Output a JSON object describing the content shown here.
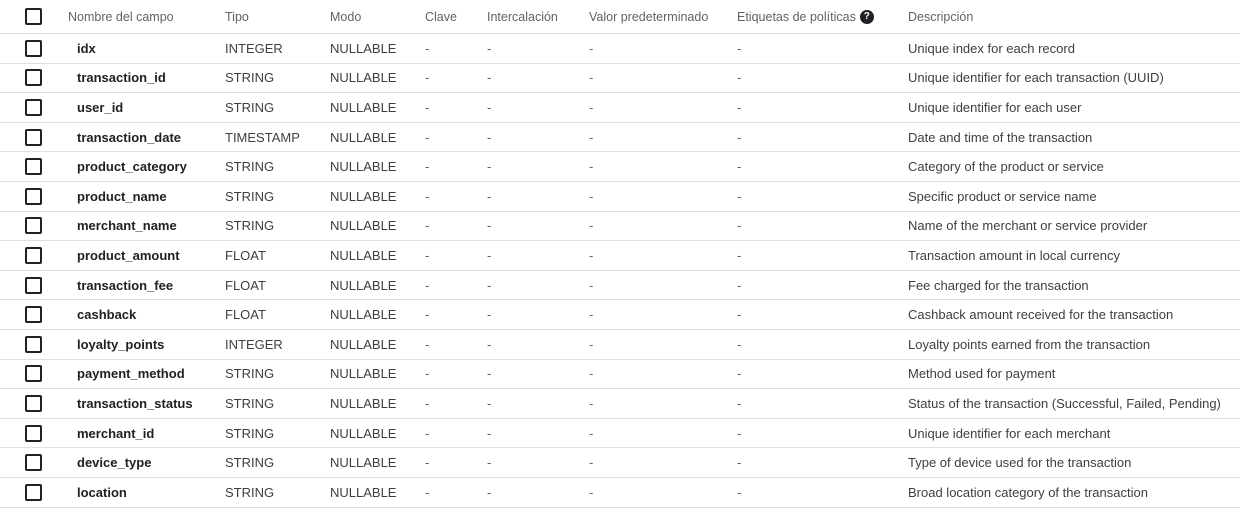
{
  "header": {
    "field_name": "Nombre del campo",
    "type": "Tipo",
    "mode": "Modo",
    "key": "Clave",
    "collation": "Intercalación",
    "default_value": "Valor predeterminado",
    "policy_tags": "Etiquetas de políticas",
    "description": "Descripción",
    "help_icon": "?"
  },
  "rows": [
    {
      "name": "idx",
      "type": "INTEGER",
      "mode": "NULLABLE",
      "key": "-",
      "collation": "-",
      "default": "-",
      "tags": "-",
      "description": "Unique index for each record"
    },
    {
      "name": "transaction_id",
      "type": "STRING",
      "mode": "NULLABLE",
      "key": "-",
      "collation": "-",
      "default": "-",
      "tags": "-",
      "description": "Unique identifier for each transaction (UUID)"
    },
    {
      "name": "user_id",
      "type": "STRING",
      "mode": "NULLABLE",
      "key": "-",
      "collation": "-",
      "default": "-",
      "tags": "-",
      "description": "Unique identifier for each user"
    },
    {
      "name": "transaction_date",
      "type": "TIMESTAMP",
      "mode": "NULLABLE",
      "key": "-",
      "collation": "-",
      "default": "-",
      "tags": "-",
      "description": "Date and time of the transaction"
    },
    {
      "name": "product_category",
      "type": "STRING",
      "mode": "NULLABLE",
      "key": "-",
      "collation": "-",
      "default": "-",
      "tags": "-",
      "description": "Category of the product or service"
    },
    {
      "name": "product_name",
      "type": "STRING",
      "mode": "NULLABLE",
      "key": "-",
      "collation": "-",
      "default": "-",
      "tags": "-",
      "description": "Specific product or service name"
    },
    {
      "name": "merchant_name",
      "type": "STRING",
      "mode": "NULLABLE",
      "key": "-",
      "collation": "-",
      "default": "-",
      "tags": "-",
      "description": "Name of the merchant or service provider"
    },
    {
      "name": "product_amount",
      "type": "FLOAT",
      "mode": "NULLABLE",
      "key": "-",
      "collation": "-",
      "default": "-",
      "tags": "-",
      "description": "Transaction amount in local currency"
    },
    {
      "name": "transaction_fee",
      "type": "FLOAT",
      "mode": "NULLABLE",
      "key": "-",
      "collation": "-",
      "default": "-",
      "tags": "-",
      "description": "Fee charged for the transaction"
    },
    {
      "name": "cashback",
      "type": "FLOAT",
      "mode": "NULLABLE",
      "key": "-",
      "collation": "-",
      "default": "-",
      "tags": "-",
      "description": "Cashback amount received for the transaction"
    },
    {
      "name": "loyalty_points",
      "type": "INTEGER",
      "mode": "NULLABLE",
      "key": "-",
      "collation": "-",
      "default": "-",
      "tags": "-",
      "description": "Loyalty points earned from the transaction"
    },
    {
      "name": "payment_method",
      "type": "STRING",
      "mode": "NULLABLE",
      "key": "-",
      "collation": "-",
      "default": "-",
      "tags": "-",
      "description": "Method used for payment"
    },
    {
      "name": "transaction_status",
      "type": "STRING",
      "mode": "NULLABLE",
      "key": "-",
      "collation": "-",
      "default": "-",
      "tags": "-",
      "description": "Status of the transaction (Successful, Failed, Pending)"
    },
    {
      "name": "merchant_id",
      "type": "STRING",
      "mode": "NULLABLE",
      "key": "-",
      "collation": "-",
      "default": "-",
      "tags": "-",
      "description": "Unique identifier for each merchant"
    },
    {
      "name": "device_type",
      "type": "STRING",
      "mode": "NULLABLE",
      "key": "-",
      "collation": "-",
      "default": "-",
      "tags": "-",
      "description": "Type of device used for the transaction"
    },
    {
      "name": "location",
      "type": "STRING",
      "mode": "NULLABLE",
      "key": "-",
      "collation": "-",
      "default": "-",
      "tags": "-",
      "description": "Broad location category of the transaction"
    }
  ]
}
